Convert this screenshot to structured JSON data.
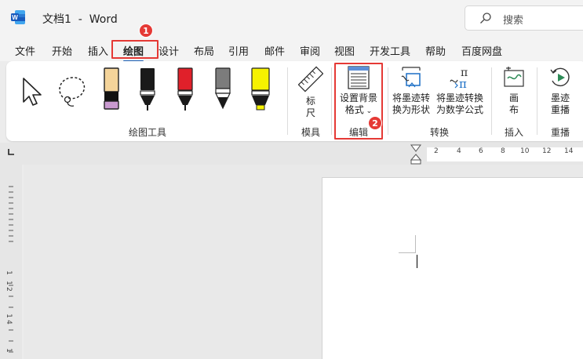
{
  "app": {
    "title": "文档1  -  Word",
    "search_placeholder": "搜索"
  },
  "menu": {
    "tabs": [
      "文件",
      "开始",
      "插入",
      "绘图",
      "设计",
      "布局",
      "引用",
      "邮件",
      "审阅",
      "视图",
      "开发工具",
      "帮助",
      "百度网盘"
    ],
    "active": "绘图"
  },
  "annotations": {
    "step1": "1",
    "step2": "2"
  },
  "ribbon": {
    "groups": {
      "drawing_tools": "绘图工具",
      "stencils": "模具",
      "edit": "编辑",
      "convert": "转换",
      "insert": "插入",
      "replay": "重播"
    },
    "buttons": {
      "ruler": "标\n尺",
      "background_line1": "设置背景",
      "background_line2": "格式",
      "ink_to_shape_line1": "将墨迹转",
      "ink_to_shape_line2": "换为形状",
      "ink_to_math_line1": "将墨迹转换",
      "ink_to_math_line2": "为数学公式",
      "canvas_line1": "画",
      "canvas_line2": "布",
      "ink_replay_line1": "墨迹",
      "ink_replay_line2": "重播"
    },
    "pens": [
      {
        "name": "pencil-pink",
        "body": "#f4d49a",
        "tip": "#c99ad0"
      },
      {
        "name": "pen-black",
        "body": "#1a1a1a",
        "tip": "#1a1a1a"
      },
      {
        "name": "pen-red",
        "body": "#e0202a",
        "tip": "#1a1a1a"
      },
      {
        "name": "pencil-gray",
        "body": "#7c7c7c",
        "tip": "#1a1a1a"
      },
      {
        "name": "highlighter-yellow",
        "body": "#f6f200",
        "tip": "#f6f200"
      }
    ]
  },
  "ruler": {
    "h_numbers": [
      "2",
      "4",
      "6",
      "8",
      "10",
      "12",
      "14"
    ],
    "v_numbers": [
      "1",
      "1",
      "2",
      "1",
      "4",
      "1"
    ]
  },
  "colors": {
    "highlight": "#e53935",
    "accent": "#1b5fb4"
  }
}
